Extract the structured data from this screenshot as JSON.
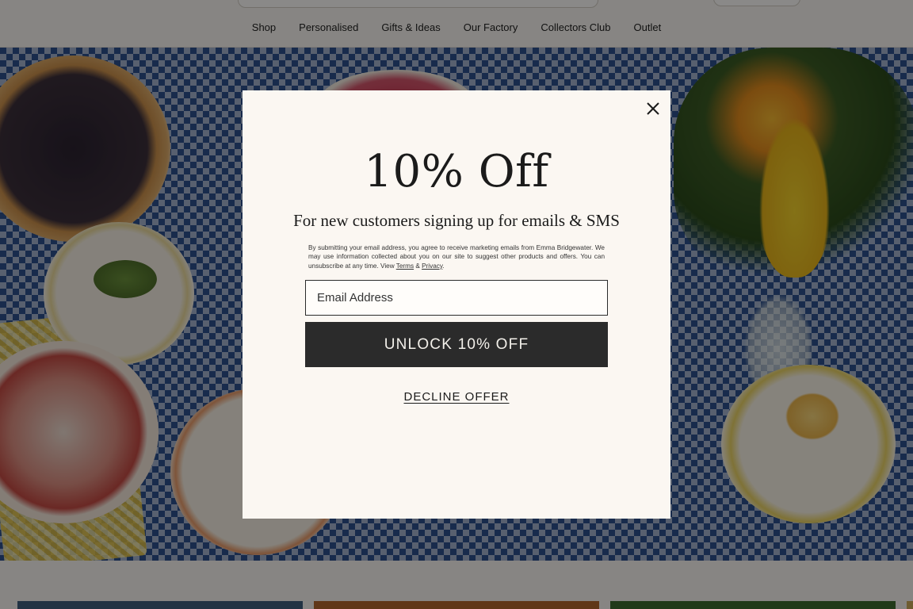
{
  "nav": {
    "items": [
      {
        "label": "Shop"
      },
      {
        "label": "Personalised"
      },
      {
        "label": "Gifts & Ideas"
      },
      {
        "label": "Our Factory"
      },
      {
        "label": "Collectors Club"
      },
      {
        "label": "Outlet"
      }
    ]
  },
  "modal": {
    "headline": "10% Off",
    "subhead": "For new customers signing up for emails & SMS",
    "disclaimer_text": "By submitting your email address, you agree to receive marketing emails from Emma Bridgewater. We may use information collected about you on our site to suggest other products and offers. You can unsubscribe at any time. View",
    "terms_link": "Terms",
    "ampersand": "&",
    "privacy_link": "Privacy",
    "period": ".",
    "email_placeholder": "Email Address",
    "email_value": "",
    "unlock_label": "UNLOCK 10% OFF",
    "decline_label": "DECLINE OFFER",
    "close_icon": "close-icon"
  },
  "colors": {
    "modal_bg": "#fbf7f2",
    "button_bg": "#2b2b2b",
    "button_text": "#f3f0ea",
    "header_bg": "#f6f3ee",
    "overlay": "rgba(0,0,0,0.45)"
  }
}
